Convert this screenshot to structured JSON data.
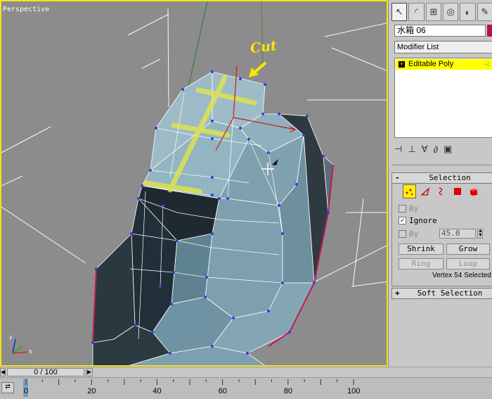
{
  "viewport": {
    "label": "Perspective",
    "annotation": "Cut",
    "border_color": "#f7e31a",
    "background": "#8c8c8c",
    "model_color": "#87a9b5",
    "vertex_color": "#3a3ae0"
  },
  "command_panel": {
    "tabs": [
      "create-icon",
      "modify-icon",
      "hierarchy-icon",
      "motion-icon",
      "display-icon",
      "utilities-icon"
    ],
    "object_name": "水箱  06",
    "object_color": "#b0163e",
    "modifier_list_label": "Modifier List",
    "stack_item": "Editable Poly",
    "selection_rollout": {
      "sign": "-",
      "title": "Selection",
      "by_vertex_label": "By",
      "ignore_label": "Ignore",
      "ignore_checked": true,
      "by_angle_label": "By",
      "angle_value": "45.0",
      "shrink_label": "Shrink",
      "grow_label": "Grow",
      "ring_label": "Ring",
      "loop_label": "Loop",
      "status": "Vertex 54 Selected"
    },
    "soft_selection": {
      "sign": "+",
      "title": "Soft Selection"
    }
  },
  "timeline": {
    "slider_text": "0 / 100",
    "ruler_ticks": [
      "0",
      "20",
      "40",
      "60",
      "80",
      "100"
    ]
  }
}
